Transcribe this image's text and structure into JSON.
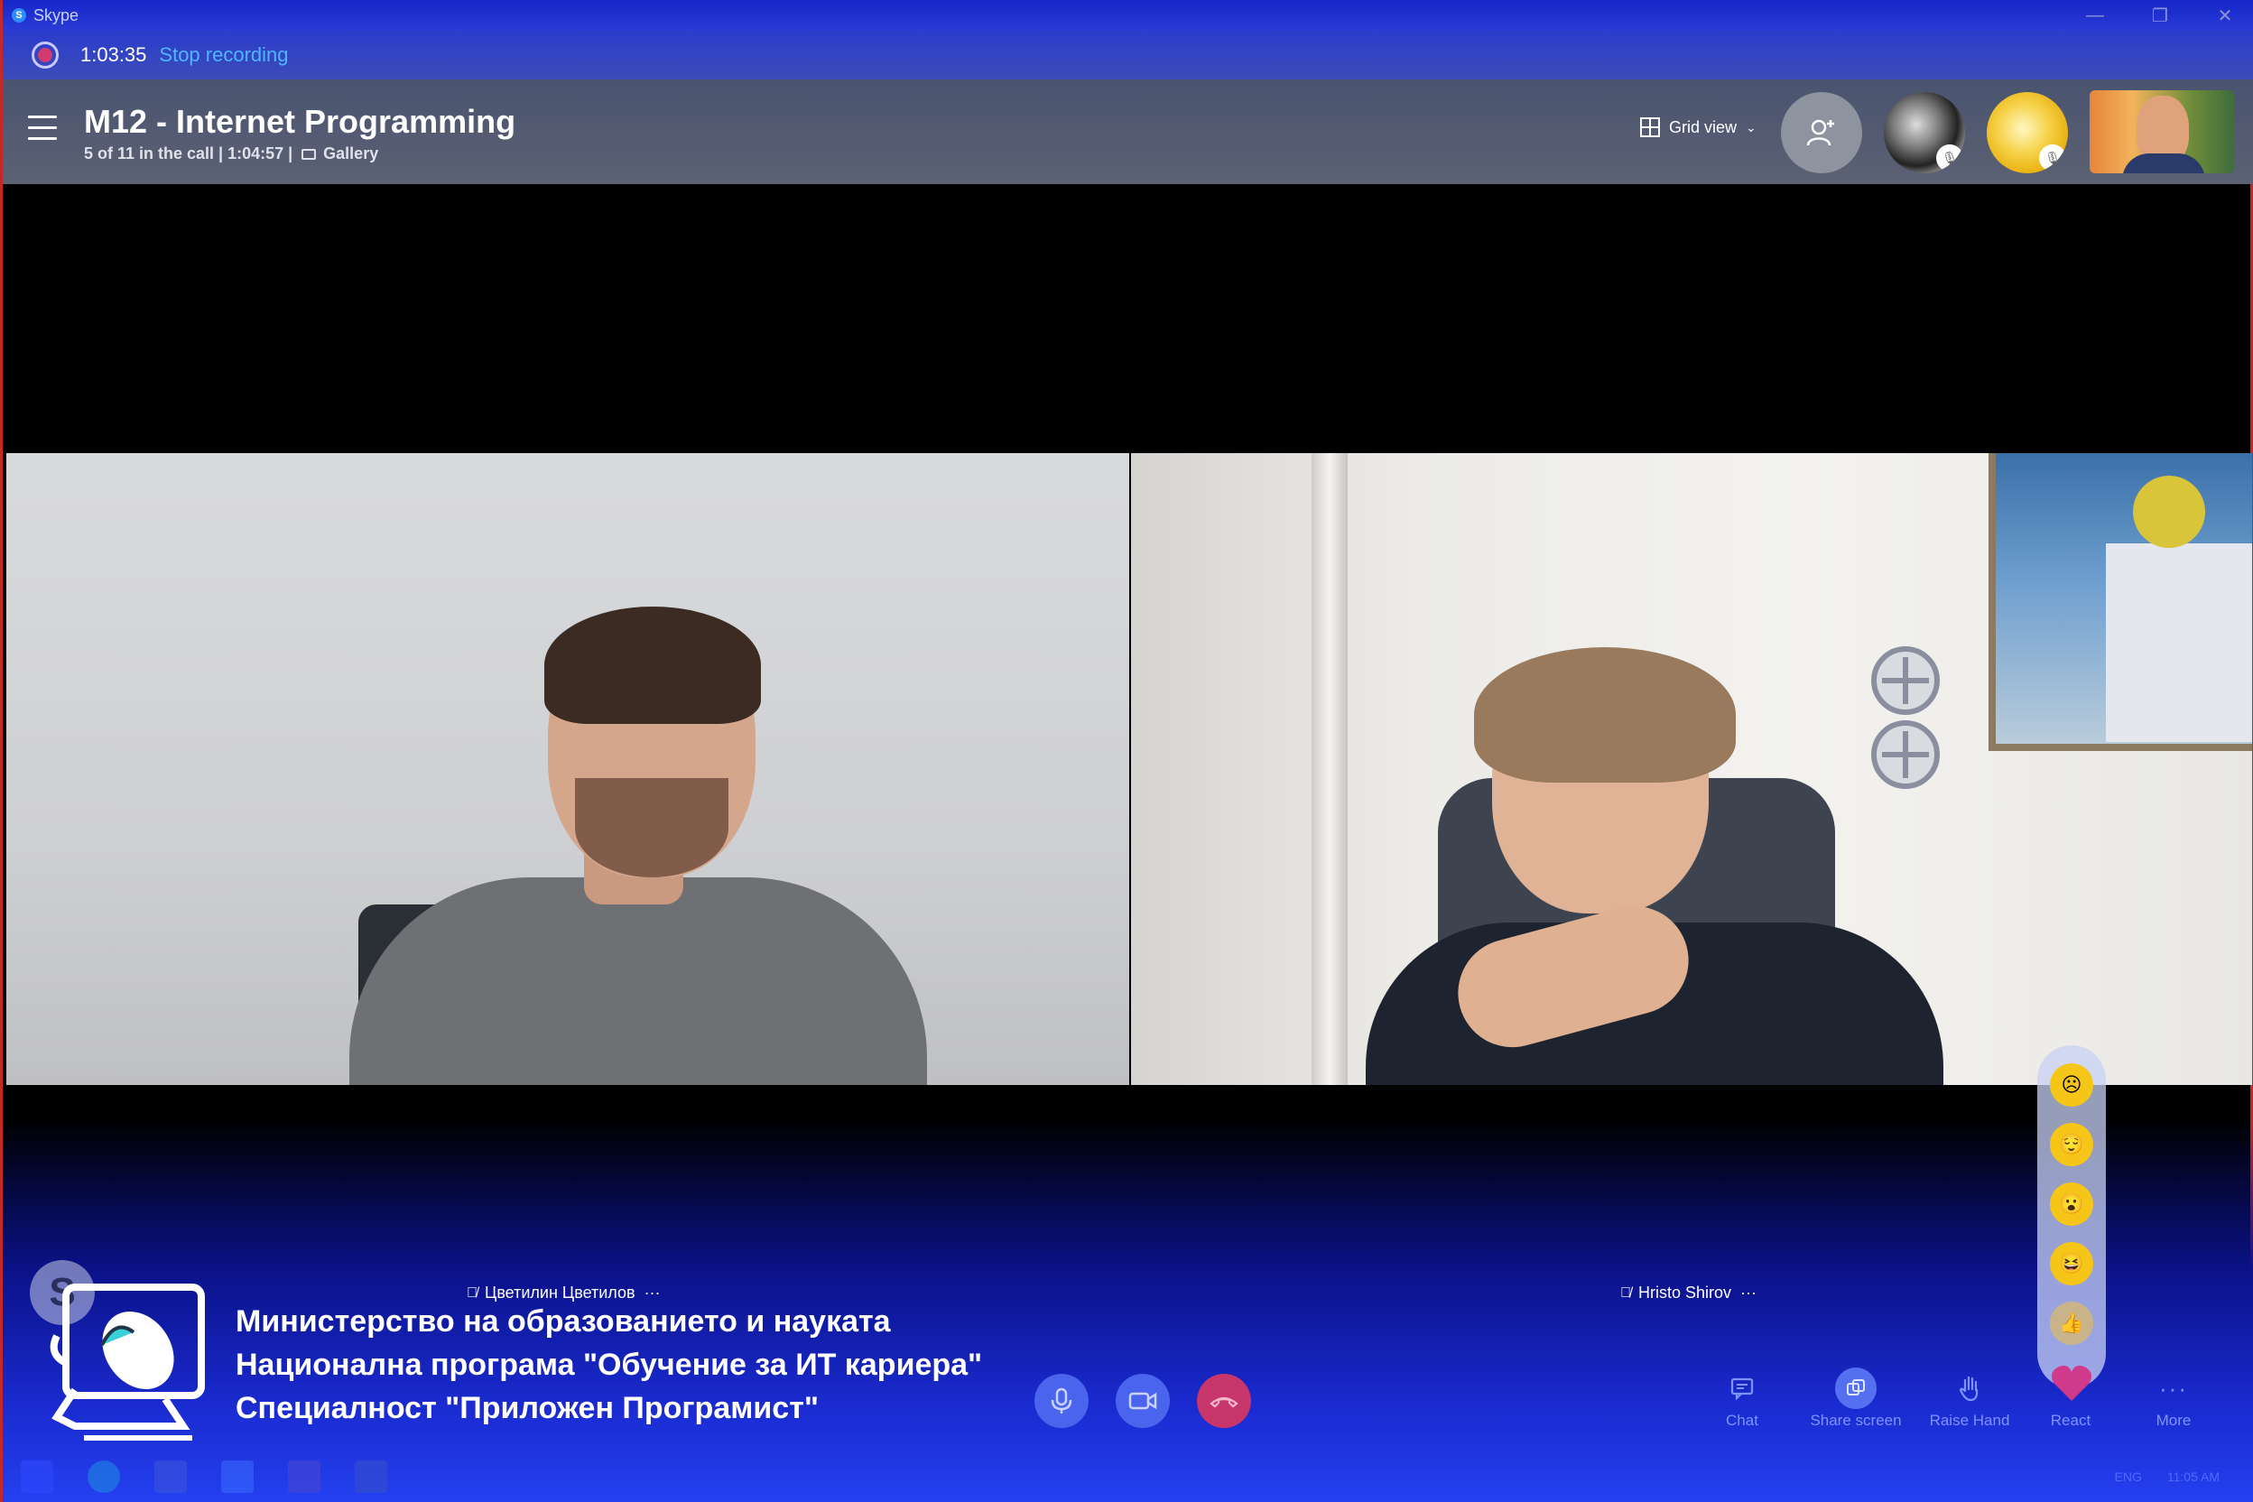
{
  "window": {
    "app_title": "Skype",
    "controls": [
      "—",
      "❐",
      "✕"
    ]
  },
  "recording": {
    "elapsed": "1:03:35",
    "stop_label": "Stop recording"
  },
  "call": {
    "title": "M12 - Internet Programming",
    "subtitle": "5 of 11 in the call | 1:04:57 |",
    "layout_label": "Gallery",
    "view_label": "Grid view"
  },
  "participants": [
    {
      "name": "Цветилин Цветилов"
    },
    {
      "name": "Hristo Shirov"
    }
  ],
  "branding": {
    "line1": "Министерство на образованието и науката",
    "line2": "Национална програма \"Обучение за ИТ кариера\"",
    "line3": "Специалност \"Приложен Програмист\""
  },
  "actions": {
    "chat": "Chat",
    "share_screen": "Share screen",
    "raise_hand": "Raise Hand",
    "react": "React",
    "more": "More"
  },
  "reactions": [
    "sad",
    "sleepy",
    "surprised",
    "laughing",
    "thumbs-up",
    "heart"
  ],
  "tray": {
    "lang": "ENG",
    "time": "11:05 AM"
  },
  "colors": {
    "accent": "#4fb6ff",
    "end_call": "#c8356a",
    "header_bg": "#5c6173",
    "action_text": "#7e93ff"
  }
}
